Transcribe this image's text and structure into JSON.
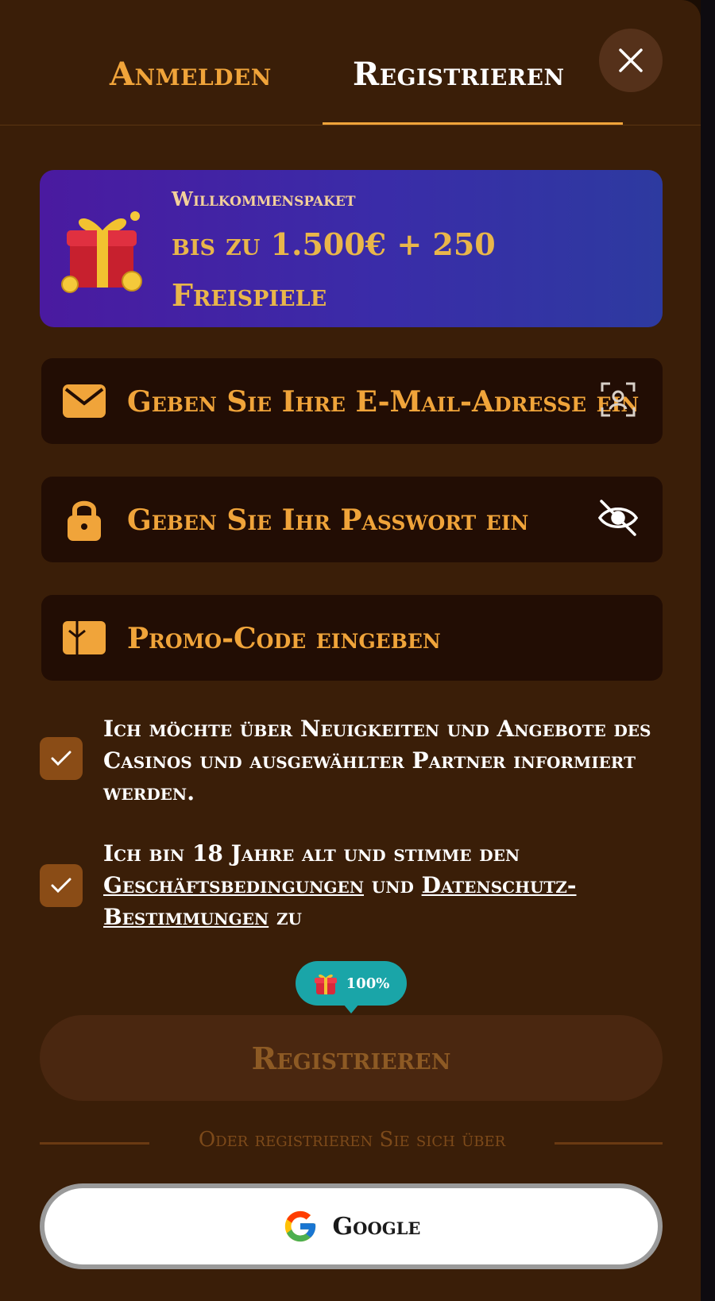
{
  "tabs": {
    "login": "Anmelden",
    "register": "Registrieren"
  },
  "promo": {
    "label": "Willkommenspaket",
    "amount": "bis zu 1.500€ + 250 Freispiele"
  },
  "fields": {
    "email_placeholder": "Geben Sie Ihre E-Mail-Adresse ein",
    "password_placeholder": "Geben Sie Ihr Passwort ein",
    "promo_placeholder": "Promo-Code eingeben"
  },
  "consents": {
    "newsletter": {
      "text": "Ich möchte über Neuigkeiten und Angebote des Casinos und ausgewählter Partner informiert werden.",
      "checked": true
    },
    "terms": {
      "prefix": "Ich bin 18 Jahre alt und stimme den",
      "terms_link": "Geschäftsbedingungen",
      "and": "und",
      "privacy_link": "Datenschutz-Bestimmungen",
      "suffix": "zu",
      "checked": true
    }
  },
  "progress_bubble": {
    "text": "100%",
    "icon": "gift-icon"
  },
  "register_button": "Registrieren",
  "divider_text": "Oder registrieren Sie sich über",
  "google_button": "Google",
  "colors": {
    "background": "#3a1e08",
    "accent": "#f0a43a",
    "field_bg": "#220d04",
    "checkbox": "#8a4c16",
    "bubble": "#1aa5a8"
  }
}
